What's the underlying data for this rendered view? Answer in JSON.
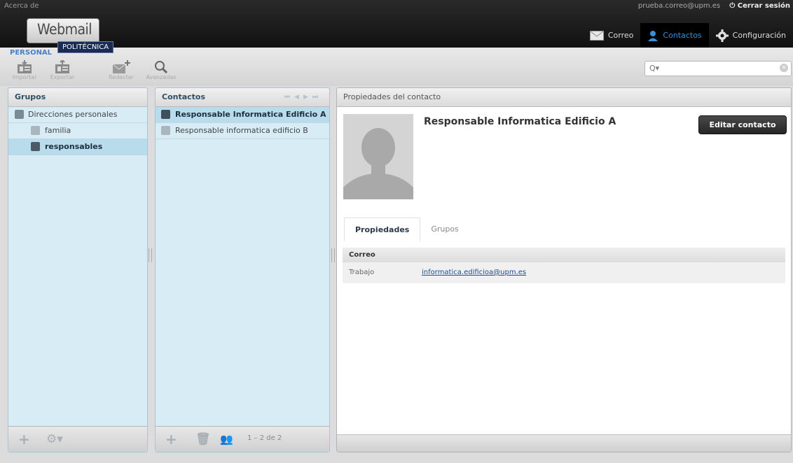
{
  "header": {
    "about_link": "Acerca de",
    "user_email": "prueba.correo@upm.es",
    "logout_label": "Cerrar sesión",
    "logo": {
      "main": "Webmail",
      "sub": "POLITÉCNICA",
      "tag": "PERSONAL"
    },
    "nav": [
      {
        "label": "Correo",
        "icon": "mail-icon"
      },
      {
        "label": "Contactos",
        "icon": "contact-icon",
        "active": true
      },
      {
        "label": "Configuración",
        "icon": "gear-icon"
      }
    ]
  },
  "toolbar": {
    "import_label": "Importar",
    "export_label": "Exportar",
    "compose_label": "Redactar",
    "advanced_label": "Avanzadas",
    "search_placeholder": ""
  },
  "groups_panel": {
    "title": "Grupos",
    "items": [
      {
        "label": "Direcciones personales",
        "level": 0
      },
      {
        "label": "familia",
        "level": 1
      },
      {
        "label": "responsables",
        "level": 1,
        "selected": true
      }
    ]
  },
  "contacts_panel": {
    "title": "Contactos",
    "items": [
      {
        "label": "Responsable Informatica Edificio A",
        "selected": true
      },
      {
        "label": "Responsable informatica edificio B"
      }
    ],
    "count": "1 – 2 de 2"
  },
  "details": {
    "title": "Propiedades del contacto",
    "name": "Responsable Informatica Edificio A",
    "edit_label": "Editar contacto",
    "tabs": [
      "Propiedades",
      "Grupos"
    ],
    "section": "Correo",
    "field_label": "Trabajo",
    "field_value": "informatica.edificioa@upm.es"
  },
  "colors": {
    "accent": "#3a8ed8",
    "selected_row": "#b9dcec",
    "panel_bg": "#d7ecf5"
  }
}
